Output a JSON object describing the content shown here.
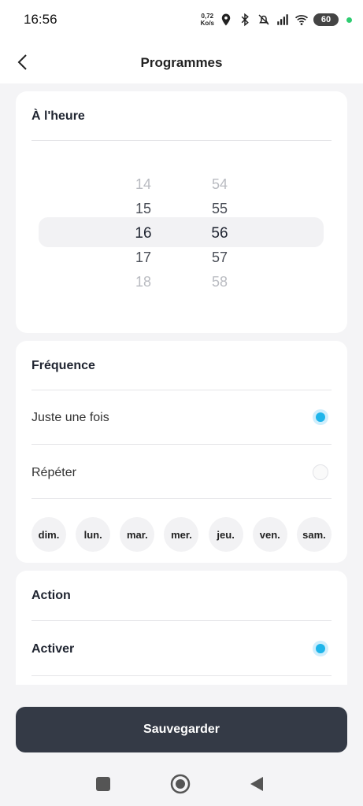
{
  "status_bar": {
    "time": "16:56",
    "net_speed_value": "0,72",
    "net_speed_unit": "Ko/s",
    "battery": "60",
    "icons": [
      "location-icon",
      "bluetooth-icon",
      "mute-icon",
      "signal-icon",
      "wifi-icon",
      "battery-icon"
    ]
  },
  "header": {
    "title": "Programmes",
    "back_icon": "chevron-left-icon"
  },
  "time_card": {
    "title": "À l'heure",
    "hours": [
      "14",
      "15",
      "16",
      "17",
      "18"
    ],
    "minutes": [
      "54",
      "55",
      "56",
      "57",
      "58"
    ],
    "selected_hour": "16",
    "selected_minute": "56"
  },
  "frequency_card": {
    "title": "Fréquence",
    "option_once": "Juste une fois",
    "option_repeat": "Répéter",
    "selected": "Juste une fois",
    "days": [
      "dim.",
      "lun.",
      "mar.",
      "mer.",
      "jeu.",
      "ven.",
      "sam."
    ]
  },
  "action_card": {
    "title": "Action",
    "option_activate": "Activer",
    "selected": "Activer"
  },
  "save_button": "Sauvegarder",
  "nav_bar": [
    "square-icon",
    "home-circle-icon",
    "back-triangle-icon"
  ],
  "colors": {
    "accent": "#1fb5ea",
    "button": "#343a46",
    "background": "#f4f4f6"
  }
}
